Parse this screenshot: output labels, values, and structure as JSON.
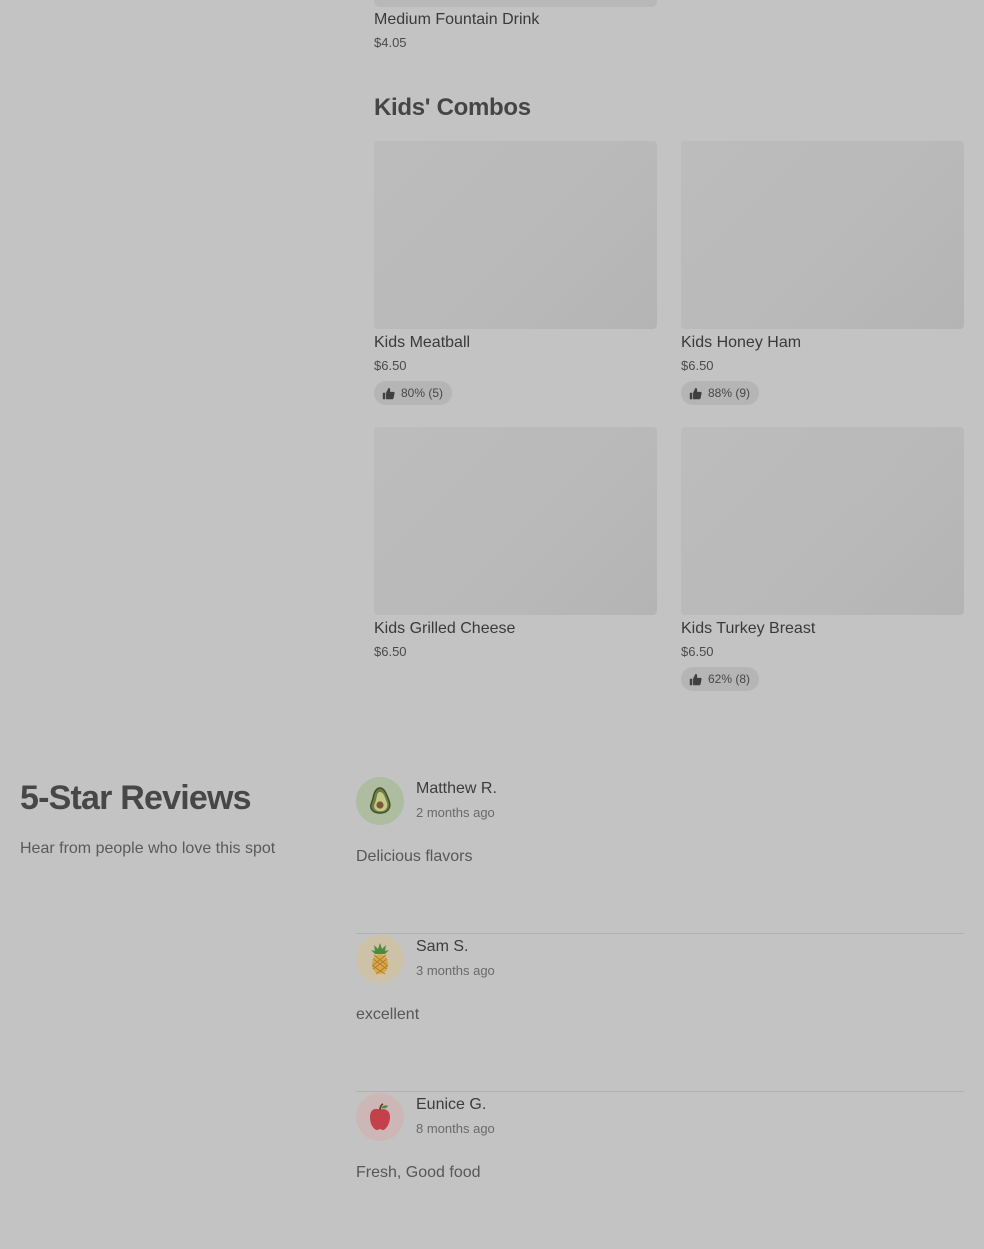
{
  "menu": {
    "previous_item": {
      "name": "Medium Fountain Drink",
      "price": "$4.05"
    },
    "section_title": "Kids' Combos",
    "items": [
      {
        "name": "Kids Meatball",
        "price": "$6.50",
        "rating": "80% (5)"
      },
      {
        "name": "Kids Honey Ham",
        "price": "$6.50",
        "rating": "88% (9)"
      },
      {
        "name": "Kids Grilled Cheese",
        "price": "$6.50",
        "rating": ""
      },
      {
        "name": "Kids Turkey Breast",
        "price": "$6.50",
        "rating": "62% (8)"
      }
    ]
  },
  "reviews": {
    "title": "5-Star Reviews",
    "subtitle": "Hear from people who love this spot",
    "items": [
      {
        "name": "Matthew R.",
        "date": "2 months ago",
        "text": "Delicious flavors",
        "avatar_icon": "avocado-icon",
        "avatar_bg": "#aebca0"
      },
      {
        "name": "Sam S.",
        "date": "3 months ago",
        "text": "excellent",
        "avatar_icon": "pineapple-icon",
        "avatar_bg": "#cdc2a8"
      },
      {
        "name": "Eunice G.",
        "date": "8 months ago",
        "text": "Fresh, Good food",
        "avatar_icon": "apple-icon",
        "avatar_bg": "#cdb6b6"
      }
    ]
  },
  "colors": {
    "background": "#c3c3c3",
    "rating_pill": "#b5b5b5",
    "image_placeholder": "#bababa"
  }
}
